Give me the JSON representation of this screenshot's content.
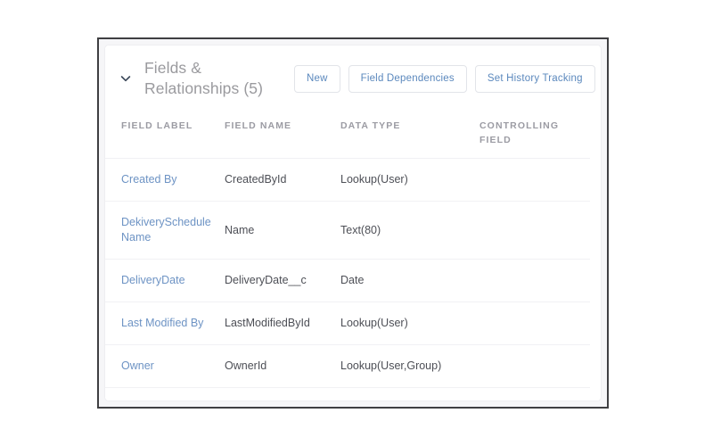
{
  "card": {
    "collapse_icon": "chevron-down-icon",
    "title": "Fields &\nRelationships (5)",
    "actions": [
      {
        "label": "New",
        "name": "new-button"
      },
      {
        "label": "Field Dependencies",
        "name": "field-dependencies-button"
      },
      {
        "label": "Set History Tracking",
        "name": "set-history-tracking-button"
      }
    ]
  },
  "table": {
    "columns": [
      {
        "label": "FIELD LABEL"
      },
      {
        "label": "FIELD NAME"
      },
      {
        "label": "DATA TYPE"
      },
      {
        "label": "CONTROLLING FIELD"
      }
    ],
    "rows": [
      {
        "field_label": "Created By",
        "field_name": "CreatedById",
        "data_type": "Lookup(User)",
        "controlling_field": ""
      },
      {
        "field_label": "DekiverySchedule Name",
        "field_name": "Name",
        "data_type": "Text(80)",
        "controlling_field": ""
      },
      {
        "field_label": "DeliveryDate",
        "field_name": "DeliveryDate__c",
        "data_type": "Date",
        "controlling_field": ""
      },
      {
        "field_label": "Last Modified By",
        "field_name": "LastModifiedById",
        "data_type": "Lookup(User)",
        "controlling_field": ""
      },
      {
        "field_label": "Owner",
        "field_name": "OwnerId",
        "data_type": "Lookup(User,Group)",
        "controlling_field": ""
      }
    ]
  },
  "colors": {
    "link": "#6d93c4",
    "button_text": "#5b88bd",
    "header_title": "#9a9a9e",
    "column_header": "#9b9ba3",
    "cell_text": "#4d4f56",
    "divider": "#f1f1f4",
    "frame": "#3f3f42"
  }
}
